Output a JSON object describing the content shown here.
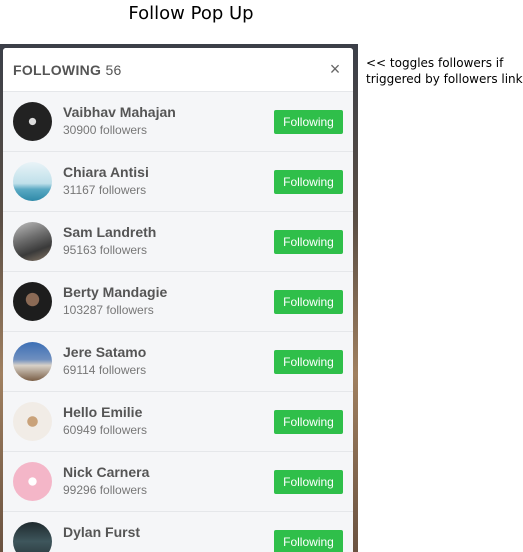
{
  "page_title": "Follow Pop Up",
  "annotation": "<< toggles followers if triggered by followers link",
  "modal": {
    "title_label": "FOLLOWING",
    "title_count": "56",
    "close_symbol": "×"
  },
  "users": [
    {
      "name": "Vaibhav Mahajan",
      "followers": "30900 followers",
      "button": "Following"
    },
    {
      "name": "Chiara Antisi",
      "followers": "31167 followers",
      "button": "Following"
    },
    {
      "name": "Sam Landreth",
      "followers": "95163 followers",
      "button": "Following"
    },
    {
      "name": "Berty Mandagie",
      "followers": "103287 followers",
      "button": "Following"
    },
    {
      "name": "Jere Satamo",
      "followers": "69114 followers",
      "button": "Following"
    },
    {
      "name": "Hello Emilie",
      "followers": "60949 followers",
      "button": "Following"
    },
    {
      "name": "Nick Carnera",
      "followers": "99296 followers",
      "button": "Following"
    },
    {
      "name": "Dylan Furst",
      "followers": "",
      "button": "Following"
    }
  ],
  "colors": {
    "following_button": "#2fbf4a",
    "list_background": "#f5f6f8"
  }
}
